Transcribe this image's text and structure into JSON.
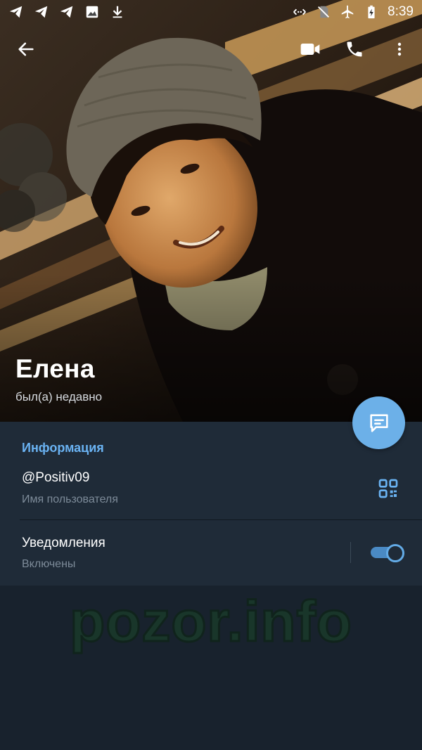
{
  "status_bar": {
    "time": "8:39",
    "left_icons": [
      "telegram-icon",
      "telegram-icon",
      "telegram-icon",
      "image-icon",
      "download-icon"
    ],
    "right_icons": [
      "data-saver-icon",
      "no-sim-icon",
      "airplane-icon",
      "battery-charging-icon"
    ]
  },
  "toolbar": {
    "back_icon": "arrow-left-icon",
    "video_call_icon": "video-camera-icon",
    "call_icon": "phone-icon",
    "menu_icon": "more-vertical-icon"
  },
  "profile": {
    "name": "Елена",
    "last_seen": "был(а) недавно"
  },
  "fab": {
    "icon": "message-icon"
  },
  "info": {
    "section_title": "Информация",
    "username": "@Positiv09",
    "username_caption": "Имя пользователя",
    "notifications_label": "Уведомления",
    "notifications_status": "Включены",
    "notifications_enabled": true
  },
  "watermark": "pozor.info",
  "colors": {
    "accent": "#6ab3f3",
    "fab": "#6cb0e8",
    "card": "#1f2b38",
    "background": "#18222d"
  }
}
